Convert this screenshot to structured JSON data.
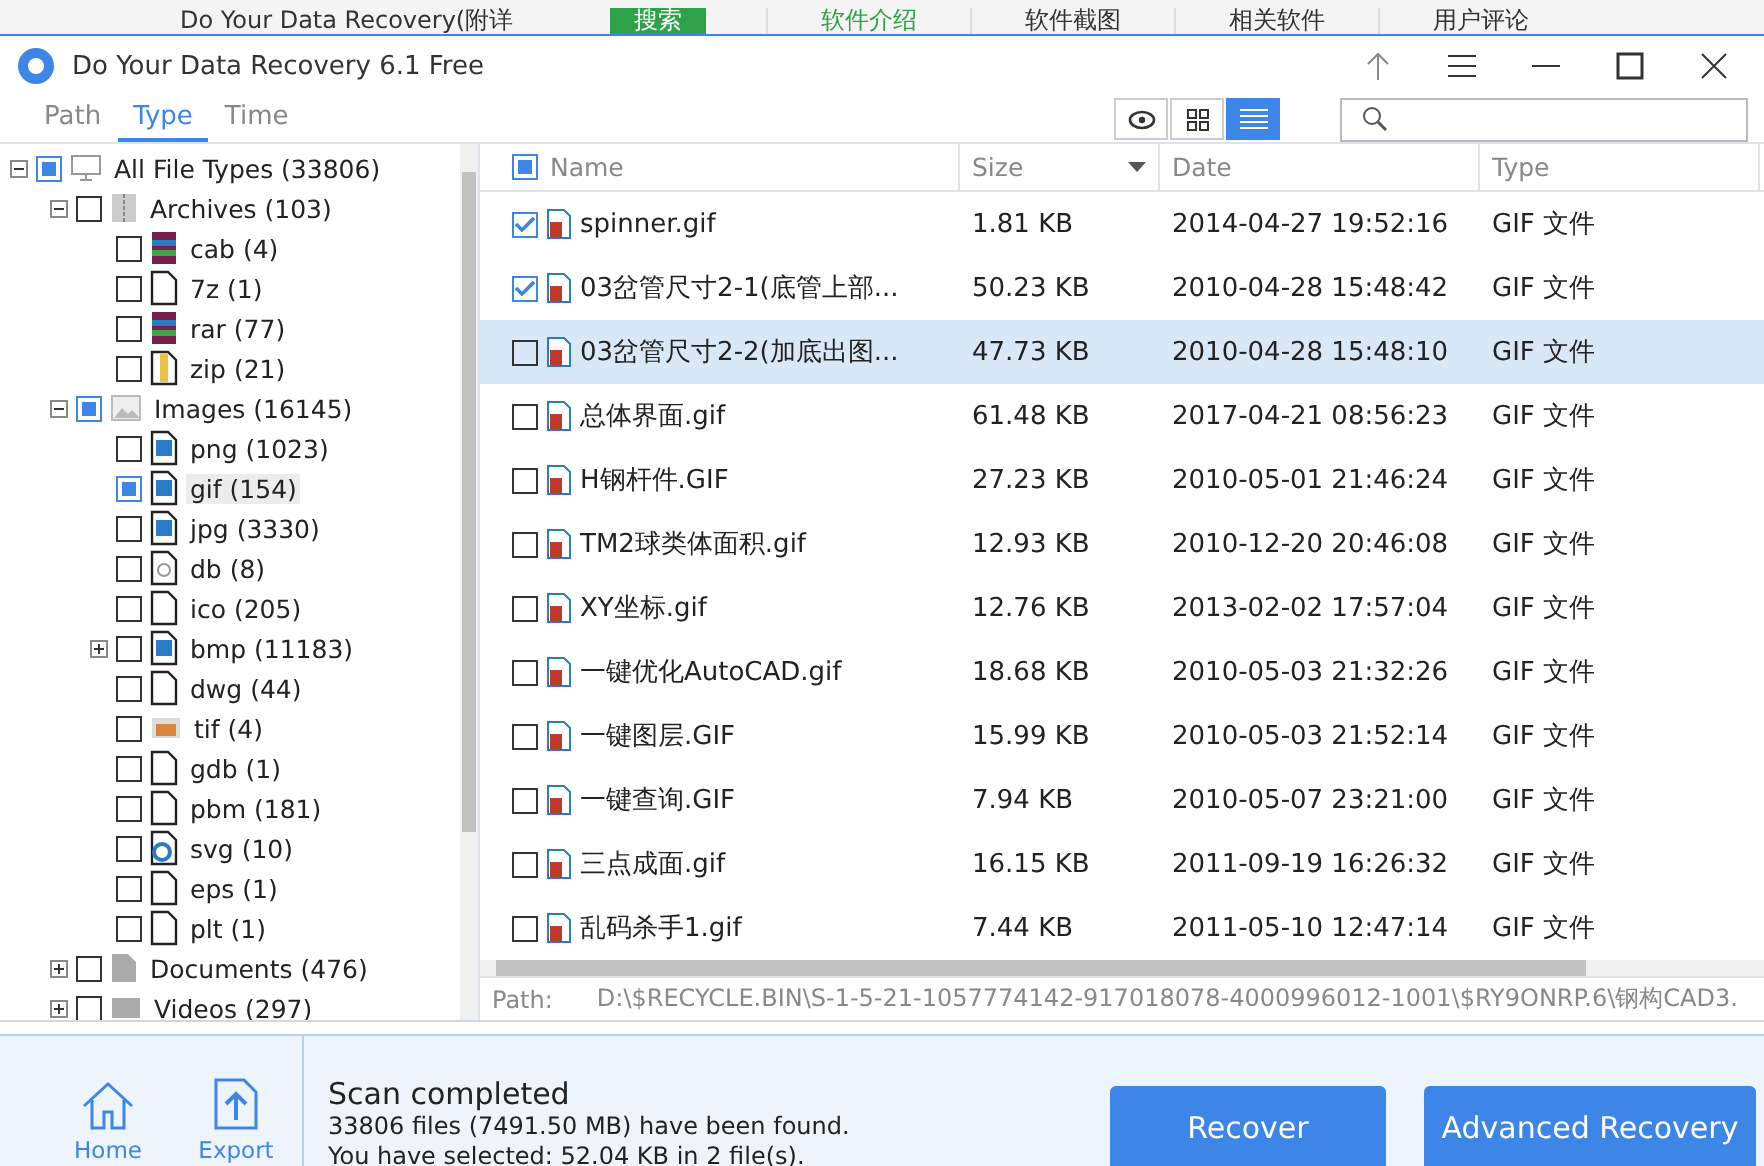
{
  "web_strip": {
    "page_title": "Do Your Data Recovery(附详",
    "search_button": "搜索",
    "nav": [
      "软件介绍",
      "软件截图",
      "相关软件",
      "用户评论"
    ]
  },
  "window": {
    "title": "Do Your Data Recovery 6.1 Free"
  },
  "tabs": [
    {
      "label": "Path",
      "selected": false
    },
    {
      "label": "Type",
      "selected": true
    },
    {
      "label": "Time",
      "selected": false
    }
  ],
  "views": [
    {
      "kind": "preview",
      "selected": false
    },
    {
      "kind": "grid",
      "selected": false
    },
    {
      "kind": "list",
      "selected": true
    }
  ],
  "tree": [
    {
      "label": "All File Types (33806)",
      "kind": "computer",
      "checked": true,
      "expanded": true,
      "children": [
        {
          "label": "Archives (103)",
          "kind": "archive",
          "checked": false,
          "expanded": true,
          "children": [
            {
              "label": "cab (4)",
              "kind": "rar",
              "checked": false
            },
            {
              "label": "7z (1)",
              "kind": "blank",
              "checked": false
            },
            {
              "label": "rar (77)",
              "kind": "rar",
              "checked": false
            },
            {
              "label": "zip (21)",
              "kind": "zip",
              "checked": false
            }
          ]
        },
        {
          "label": "Images (16145)",
          "kind": "picture",
          "checked": true,
          "expanded": true,
          "children": [
            {
              "label": "png (1023)",
              "kind": "image",
              "checked": false
            },
            {
              "label": "gif (154)",
              "kind": "image",
              "checked": true,
              "selected": true
            },
            {
              "label": "jpg (3330)",
              "kind": "image",
              "checked": false
            },
            {
              "label": "db (8)",
              "kind": "db",
              "checked": false
            },
            {
              "label": "ico (205)",
              "kind": "blank",
              "checked": false
            },
            {
              "label": "bmp (11183)",
              "kind": "image",
              "checked": false,
              "expanded": false
            },
            {
              "label": "dwg (44)",
              "kind": "blank",
              "checked": false
            },
            {
              "label": "tif (4)",
              "kind": "photo",
              "checked": false
            },
            {
              "label": "gdb (1)",
              "kind": "blank",
              "checked": false
            },
            {
              "label": "pbm (181)",
              "kind": "blank",
              "checked": false
            },
            {
              "label": "svg (10)",
              "kind": "browser",
              "checked": false
            },
            {
              "label": "eps (1)",
              "kind": "blank",
              "checked": false
            },
            {
              "label": "plt (1)",
              "kind": "blank",
              "checked": false
            }
          ]
        },
        {
          "label": "Documents (476)",
          "kind": "document",
          "checked": false,
          "expanded": false
        },
        {
          "label": "Videos (297)",
          "kind": "video",
          "checked": false,
          "expanded": false
        }
      ]
    }
  ],
  "table": {
    "all_checked": true,
    "columns": [
      "Name",
      "Size",
      "Date",
      "Type"
    ],
    "rows": [
      {
        "checked": true,
        "selected": false,
        "name": "spinner.gif",
        "size": "1.81 KB",
        "date": "2014-04-27 19:52:16",
        "type": "GIF 文件"
      },
      {
        "checked": true,
        "selected": false,
        "name": "03岔管尺寸2-1(底管上部...",
        "size": "50.23 KB",
        "date": "2010-04-28 15:48:42",
        "type": "GIF 文件"
      },
      {
        "checked": false,
        "selected": true,
        "name": "03岔管尺寸2-2(加底出图...",
        "size": "47.73 KB",
        "date": "2010-04-28 15:48:10",
        "type": "GIF 文件"
      },
      {
        "checked": false,
        "selected": false,
        "name": "总体界面.gif",
        "size": "61.48 KB",
        "date": "2017-04-21 08:56:23",
        "type": "GIF 文件"
      },
      {
        "checked": false,
        "selected": false,
        "name": "H钢杆件.GIF",
        "size": "27.23 KB",
        "date": "2010-05-01 21:46:24",
        "type": "GIF 文件"
      },
      {
        "checked": false,
        "selected": false,
        "name": "TM2球类体面积.gif",
        "size": "12.93 KB",
        "date": "2010-12-20 20:46:08",
        "type": "GIF 文件"
      },
      {
        "checked": false,
        "selected": false,
        "name": "XY坐标.gif",
        "size": "12.76 KB",
        "date": "2013-02-02 17:57:04",
        "type": "GIF 文件"
      },
      {
        "checked": false,
        "selected": false,
        "name": "一键优化AutoCAD.gif",
        "size": "18.68 KB",
        "date": "2010-05-03 21:32:26",
        "type": "GIF 文件"
      },
      {
        "checked": false,
        "selected": false,
        "name": "一键图层.GIF",
        "size": "15.99 KB",
        "date": "2010-05-03 21:52:14",
        "type": "GIF 文件"
      },
      {
        "checked": false,
        "selected": false,
        "name": "一键查询.GIF",
        "size": "7.94 KB",
        "date": "2010-05-07 23:21:00",
        "type": "GIF 文件"
      },
      {
        "checked": false,
        "selected": false,
        "name": "三点成面.gif",
        "size": "16.15 KB",
        "date": "2011-09-19 16:26:32",
        "type": "GIF 文件"
      },
      {
        "checked": false,
        "selected": false,
        "name": "乱码杀手1.gif",
        "size": "7.44 KB",
        "date": "2011-05-10 12:47:14",
        "type": "GIF 文件"
      }
    ]
  },
  "path_bar": {
    "label": "Path:",
    "value": "D:\\$RECYCLE.BIN\\S-1-5-21-1057774142-917018078-4000996012-1001\\$RY9ONRP.6\\钢构CAD3."
  },
  "footer": {
    "nav": [
      {
        "kind": "home",
        "label": "Home"
      },
      {
        "kind": "export",
        "label": "Export"
      }
    ],
    "status_title": "Scan completed",
    "status_lines": [
      "33806 files (7491.50 MB) have been found.",
      "You have selected: 52.04 KB in 2 file(s)."
    ],
    "buttons": [
      "Recover",
      "Advanced Recovery"
    ]
  }
}
